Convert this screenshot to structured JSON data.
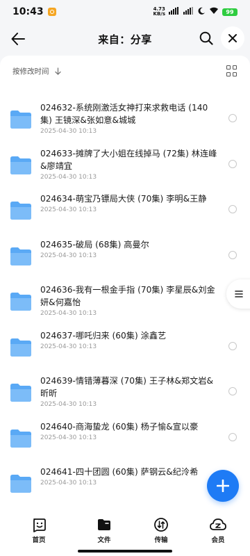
{
  "status_bar": {
    "time": "10:43",
    "net_speed_value": "4.73",
    "net_speed_unit": "KB/s",
    "battery": "99"
  },
  "header": {
    "title": "来自：分享"
  },
  "sort": {
    "label": "按修改时间"
  },
  "files": [
    {
      "name": "024632-系统刚激活女神打来求救电话 (140集) 王镜深&张如意&城城",
      "date": "2025-04-30 10:13"
    },
    {
      "name": "024633-摊牌了大小姐在线掉马 (72集) 林连峰&廖靖宜",
      "date": "2025-04-30 10:13"
    },
    {
      "name": "024634-萌宝乃镖局大侠 (70集) 李明&王静",
      "date": "2025-04-30 10:13"
    },
    {
      "name": "024635-破局 (68集) 高曼尔",
      "date": "2025-04-30 10:13"
    },
    {
      "name": "024636-我有一根金手指 (70集) 李星辰&刘金妍&何嘉怡",
      "date": "2025-04-30 10:13"
    },
    {
      "name": "024637-哪吒归来 (60集) 涂鑫艺",
      "date": "2025-04-30 10:13"
    },
    {
      "name": "024639-情错薄暮深 (70集) 王子林&郑文岩&昕昕",
      "date": "2025-04-30 10:13"
    },
    {
      "name": "024640-商海蛰龙 (60集) 杨子愉&宣以豪",
      "date": "2025-04-30 10:13"
    },
    {
      "name": "024641-四十团圆 (60集) 萨钢云&纪泠希",
      "date": "2025-04-30 10:13"
    }
  ],
  "bottom_nav": [
    {
      "label": "首页",
      "icon": "home-face-icon"
    },
    {
      "label": "文件",
      "icon": "folder-icon"
    },
    {
      "label": "传输",
      "icon": "transfer-icon"
    },
    {
      "label": "会员",
      "icon": "vip-cloud-icon"
    }
  ],
  "colors": {
    "accent": "#1e7bf5",
    "folder": "#5aa9f5",
    "background": "#f5f6f8"
  }
}
